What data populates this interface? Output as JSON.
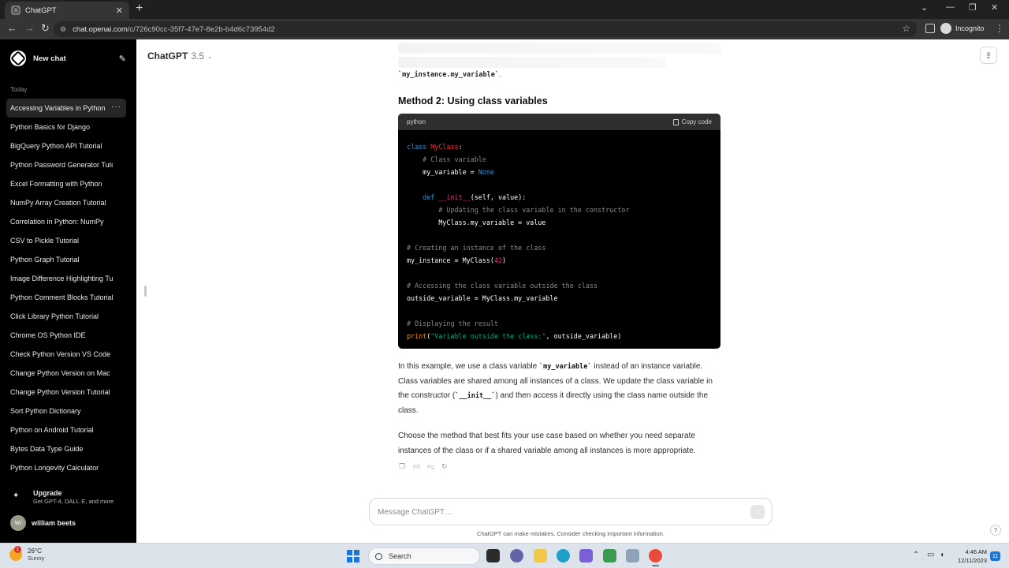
{
  "browser": {
    "tab_title": "ChatGPT",
    "url_host": "chat.openai.com",
    "url_path": "/c/726c90cc-35f7-47e7-8e2b-b4d6c73954d2",
    "incognito_label": "Incognito"
  },
  "sidebar": {
    "new_chat_label": "New chat",
    "section_today": "Today",
    "chats": [
      {
        "label": "Accessing Variables in Python"
      },
      {
        "label": "Python Basics for Django"
      },
      {
        "label": "BigQuery Python API Tutorial"
      },
      {
        "label": "Python Password Generator Tutorial"
      },
      {
        "label": "Excel Formatting with Python"
      },
      {
        "label": "NumPy Array Creation Tutorial"
      },
      {
        "label": "Correlation in Python: NumPy"
      },
      {
        "label": "CSV to Pickle Tutorial"
      },
      {
        "label": "Python Graph Tutorial"
      },
      {
        "label": "Image Difference Highlighting Tutorial"
      },
      {
        "label": "Python Comment Blocks Tutorial"
      },
      {
        "label": "Click Library Python Tutorial"
      },
      {
        "label": "Chrome OS Python IDE"
      },
      {
        "label": "Check Python Version VS Code"
      },
      {
        "label": "Change Python Version on Mac"
      },
      {
        "label": "Change Python Version Tutorial"
      },
      {
        "label": "Sort Python Dictionary"
      },
      {
        "label": "Python on Android Tutorial"
      },
      {
        "label": "Bytes Data Type Guide"
      },
      {
        "label": "Python Longevity Calculator"
      }
    ],
    "upgrade_title": "Upgrade",
    "upgrade_subtitle": "Get GPT-4, DALL·E, and more",
    "user_initials": "WI",
    "user_name": "william beets"
  },
  "header": {
    "model_name": "ChatGPT",
    "model_version": "3.5"
  },
  "conversation": {
    "prev_code_text": "`my_instance.my_variable`",
    "prev_code_suffix": ".",
    "method_heading": "Method 2: Using class variables",
    "code_language": "python",
    "copy_code_label": "Copy code",
    "para1_a": "In this example, we use a class variable ",
    "para1_code1": "`my_variable`",
    "para1_b": " instead of an instance variable. Class variables are shared among all instances of a class. We update the class variable in the constructor (",
    "para1_code2": "`__init__`",
    "para1_c": ") and then access it directly using the class name outside the class.",
    "para2": "Choose the method that best fits your use case based on whether you need separate instances of the class or if a shared variable among all instances is more appropriate."
  },
  "composer": {
    "placeholder": "Message ChatGPT…",
    "disclaimer": "ChatGPT can make mistakes. Consider checking important information."
  },
  "taskbar": {
    "weather_temp": "26°C",
    "weather_desc": "Sunny",
    "weather_badge": "1",
    "search_label": "Search",
    "time": "4:46 AM",
    "date": "12/11/2023",
    "notification_count": "11"
  },
  "colors": {
    "sidebar_bg": "#000000",
    "code_bg": "#000000",
    "keyword": "#2e95d3",
    "class_name": "#f22c3d",
    "string": "#00a67d",
    "comment": "#8a8a8a",
    "number": "#df3079"
  },
  "icons": [
    "chatgpt-logo-icon",
    "edit-icon",
    "more-icon",
    "share-icon",
    "copy-icon",
    "thumbs-up-icon",
    "thumbs-down-icon",
    "regenerate-icon",
    "send-icon",
    "help-icon",
    "windows-icon",
    "search-icon"
  ]
}
